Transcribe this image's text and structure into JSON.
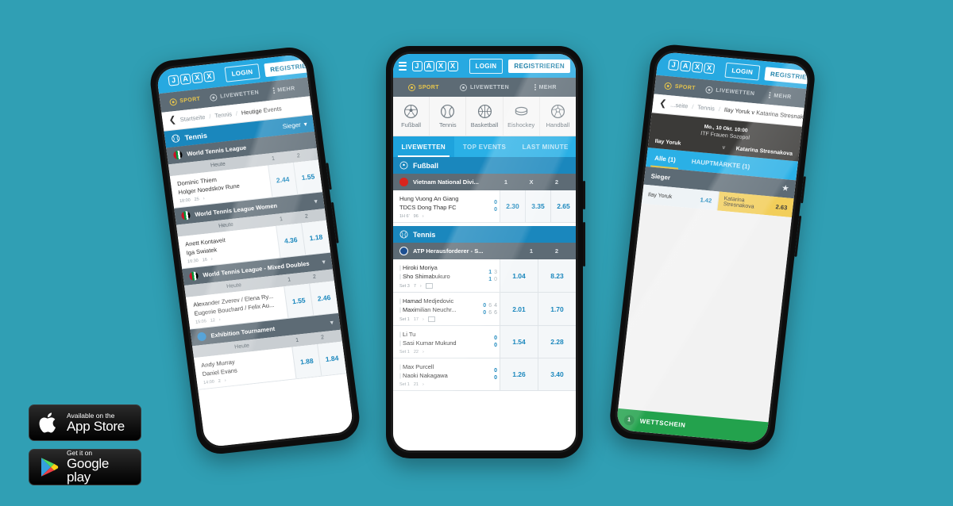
{
  "page": {
    "background_color": "#309fb4",
    "brand": "JAXX",
    "accent_blue": "#27a9e1",
    "accent_dark_blue": "#1a87bd",
    "accent_gray": "#5d6b75",
    "accent_yellow": "#f2ce5a",
    "accent_green": "#23a24d"
  },
  "chrome": {
    "logo_letters": [
      "J",
      "A",
      "X",
      "X"
    ],
    "login_label": "LOGIN",
    "register_label": "REGISTRIEREN",
    "nav": [
      {
        "label": "SPORT",
        "icon": "soccer-ball-icon",
        "active": true
      },
      {
        "label": "LIVEWETTEN",
        "icon": "live-dot-icon",
        "active": false
      },
      {
        "label": "MEHR",
        "icon": "kebab-menu-icon",
        "active": false
      }
    ]
  },
  "phone_left": {
    "breadcrumb": {
      "back_icon": "chevron-left-icon",
      "items": [
        "Startseite",
        "Tennis",
        "Heutige Events"
      ],
      "separator": "/"
    },
    "section": {
      "label": "Tennis",
      "icon": "tennis-ball-icon",
      "market": "Sieger",
      "chevron": "chevron-down-icon"
    },
    "groups": [
      {
        "league": "World Tennis League",
        "flag": "uae-flag-icon",
        "date_label": "Heute",
        "columns": [
          "1",
          "2"
        ],
        "events": [
          {
            "home": "Dominic Thiem",
            "away": "Holger Noedskov Rune",
            "time": "18:00",
            "markets": "25",
            "odds": [
              "2.44",
              "1.55"
            ]
          }
        ]
      },
      {
        "league": "World Tennis League Women",
        "flag": "uae-flag-icon",
        "date_label": "Heute",
        "columns": [
          "1",
          "2"
        ],
        "events": [
          {
            "home": "Anett Kontaveit",
            "away": "Iga Swiatek",
            "time": "16:30",
            "markets": "16",
            "odds": [
              "4.36",
              "1.18"
            ]
          }
        ]
      },
      {
        "league": "World Tennis League - Mixed Doubles",
        "flag": "uae-flag-icon",
        "date_label": "Heute",
        "columns": [
          "1",
          "2"
        ],
        "events": [
          {
            "home": "Alexander Zverev / Elena Ry...",
            "away": "Eugenie Bouchard / Felix Au...",
            "time": "15:05",
            "markets": "12",
            "odds": [
              "1.55",
              "2.46"
            ]
          }
        ]
      },
      {
        "league": "Exhibition Tournament",
        "flag": "generic-flag-icon",
        "date_label": "Heute",
        "columns": [
          "1",
          "2"
        ],
        "events": [
          {
            "home": "Andy Murray",
            "away": "Daniel Evans",
            "time": "14:00",
            "markets": "2",
            "odds": [
              "1.88",
              "1.84"
            ]
          }
        ]
      }
    ]
  },
  "phone_center": {
    "sports": [
      {
        "label": "Fußball",
        "icon": "soccer-ball-icon"
      },
      {
        "label": "Tennis",
        "icon": "tennis-ball-icon"
      },
      {
        "label": "Basketball",
        "icon": "basketball-icon"
      },
      {
        "label": "Eishockey",
        "icon": "hockey-puck-icon"
      },
      {
        "label": "Handball",
        "icon": "handball-icon"
      }
    ],
    "tabs": [
      {
        "label": "LIVEWETTEN",
        "active": true
      },
      {
        "label": "TOP EVENTS",
        "active": false
      },
      {
        "label": "LAST MINUTE",
        "active": false
      }
    ],
    "sections": [
      {
        "label": "Fußball",
        "icon": "soccer-ball-icon",
        "leagues": [
          {
            "name": "Vietnam National Divi...",
            "flag": "vietnam-flag-icon",
            "columns": [
              "1",
              "X",
              "2"
            ],
            "events": [
              {
                "home": "Hung Vuong An Giang",
                "away": "TDCS Dong Thap FC",
                "home_score": "0",
                "away_score": "0",
                "period": "1H 6'",
                "markets": "96",
                "odds": [
                  "2.30",
                  "3.35",
                  "2.65"
                ]
              }
            ]
          }
        ]
      },
      {
        "label": "Tennis",
        "icon": "tennis-ball-icon",
        "leagues": [
          {
            "name": "ATP Herausforderer - S...",
            "flag": "atp-flag-icon",
            "columns": [
              "1",
              "2"
            ],
            "events": [
              {
                "home": "Hiroki Moriya",
                "away": "Sho Shimabukuro",
                "home_sets": "1",
                "home_games": "3",
                "away_sets": "1",
                "away_games": "0",
                "period": "Set 3",
                "markets": "7",
                "has_scoreboard": true,
                "odds": [
                  "1.04",
                  "8.23"
                ]
              },
              {
                "home": "Hamad Medjedovic",
                "away": "Maximilian Neuchr...",
                "home_sets": "0",
                "home_games": "6",
                "home_points": "4",
                "away_sets": "0",
                "away_games": "6",
                "away_points": "6",
                "period": "Set 1",
                "markets": "17",
                "has_scoreboard": true,
                "odds": [
                  "2.01",
                  "1.70"
                ]
              },
              {
                "home": "Li Tu",
                "away": "Sasi Kumar Mukund",
                "home_sets": "0",
                "away_sets": "0",
                "period": "Set 1",
                "markets": "22",
                "has_scoreboard": false,
                "odds": [
                  "1.54",
                  "2.28"
                ]
              },
              {
                "home": "Max Purcell",
                "away": "Naoki Nakagawa",
                "home_sets": "0",
                "away_sets": "0",
                "period": "Set 1",
                "markets": "21",
                "has_scoreboard": false,
                "odds": [
                  "1.26",
                  "3.40"
                ]
              }
            ]
          }
        ]
      }
    ]
  },
  "phone_right": {
    "breadcrumb": {
      "back_icon": "chevron-left-icon",
      "items": [
        "...seite",
        "Tennis",
        "Ilay Yoruk v Katarina Stresnakova"
      ],
      "separator": "/"
    },
    "match": {
      "datetime": "Mo., 10 Okt. 10:00",
      "tournament": "ITF Frauen Sozopol",
      "player1": "Ilay Yoruk",
      "vs": "v",
      "player2": "Katarina Stresnakova"
    },
    "tabs": [
      {
        "label": "Alle (1)",
        "active": true
      },
      {
        "label": "HAUPTMÄRKTE (1)",
        "active": false
      }
    ],
    "market": {
      "name": "Sieger",
      "star_icon": "star-icon",
      "selections": [
        {
          "label": "Ilay Yoruk",
          "odds": "1.42",
          "selected": false
        },
        {
          "label": "Katarina Stresnakova",
          "odds": "2.63",
          "selected": true
        }
      ]
    },
    "betslip": {
      "count": "1",
      "label": "WETTSCHEIN"
    }
  },
  "store_badges": [
    {
      "platform": "apple",
      "icon": "apple-logo-icon",
      "small": "Available on the",
      "big": "App Store"
    },
    {
      "platform": "google",
      "icon": "google-play-icon",
      "small": "Get it on",
      "big": "Google play"
    }
  ]
}
